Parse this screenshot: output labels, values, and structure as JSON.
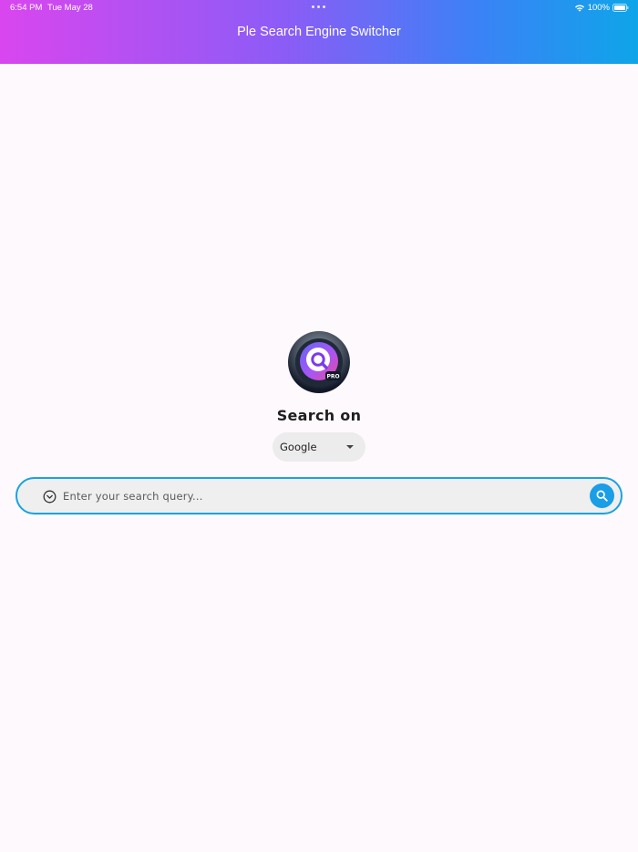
{
  "status_bar": {
    "time": "6:54 PM",
    "date": "Tue May 28",
    "battery": "100%"
  },
  "header": {
    "title": "Ple Search Engine Switcher"
  },
  "logo": {
    "badge_text": "PRO"
  },
  "main": {
    "heading": "Search on",
    "engine_selected": "Google",
    "search_placeholder": "Enter your search query..."
  },
  "colors": {
    "accent": "#1a9ee5",
    "gradient_start": "#d946ef",
    "gradient_end": "#0ea5e9",
    "background": "#fdf9fd"
  },
  "icons": {
    "history": "chevron-down-circle-icon",
    "search": "search-icon",
    "wifi": "wifi-icon",
    "battery": "battery-icon",
    "multitask": "multitask-dots-icon"
  }
}
